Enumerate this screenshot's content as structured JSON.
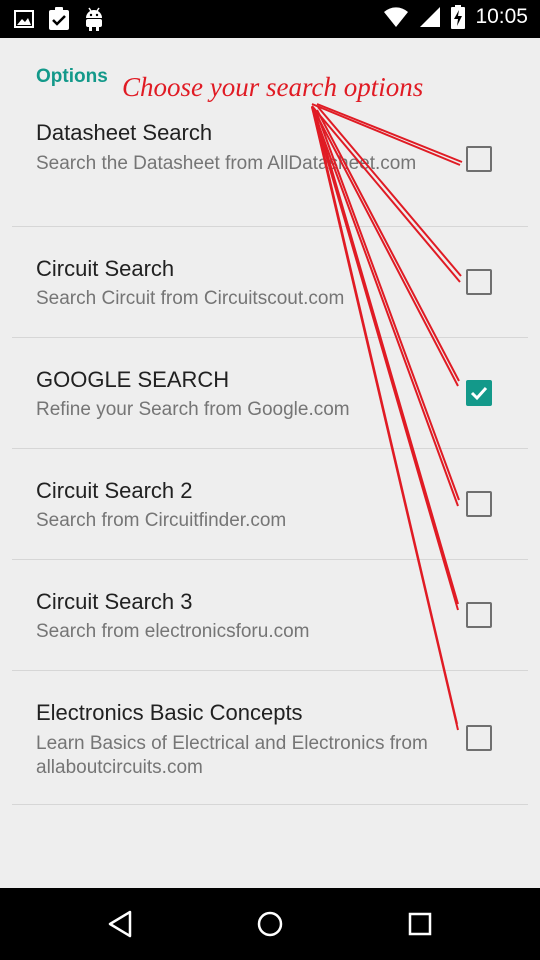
{
  "status_bar": {
    "time": "10:05",
    "icons": [
      "image-icon",
      "clipboard-check-icon",
      "android-icon",
      "wifi-icon",
      "cell-signal-icon",
      "battery-charging-icon"
    ]
  },
  "options": {
    "category_title": "Options",
    "annotation": "Choose your search options",
    "items": [
      {
        "title": "Datasheet Search",
        "summary": "Search the Datasheet from AllDatasheet.com",
        "checked": false
      },
      {
        "title": "Circuit Search",
        "summary": "Search Circuit from Circuitscout.com",
        "checked": false
      },
      {
        "title": "GOOGLE SEARCH",
        "summary": "Refine your Search from Google.com",
        "checked": true
      },
      {
        "title": "Circuit Search 2",
        "summary": "Search from Circuitfinder.com",
        "checked": false
      },
      {
        "title": "Circuit Search 3",
        "summary": "Search from electronicsforu.com",
        "checked": false
      },
      {
        "title": "Electronics Basic Concepts",
        "summary": "Learn Basics of Electrical and Electronics from allaboutcircuits.com",
        "checked": false
      }
    ]
  },
  "colors": {
    "accent": "#13998a",
    "annotation": "#e01b24"
  },
  "nav_bar": {
    "icons": [
      "back-icon",
      "home-icon",
      "recents-icon"
    ]
  }
}
